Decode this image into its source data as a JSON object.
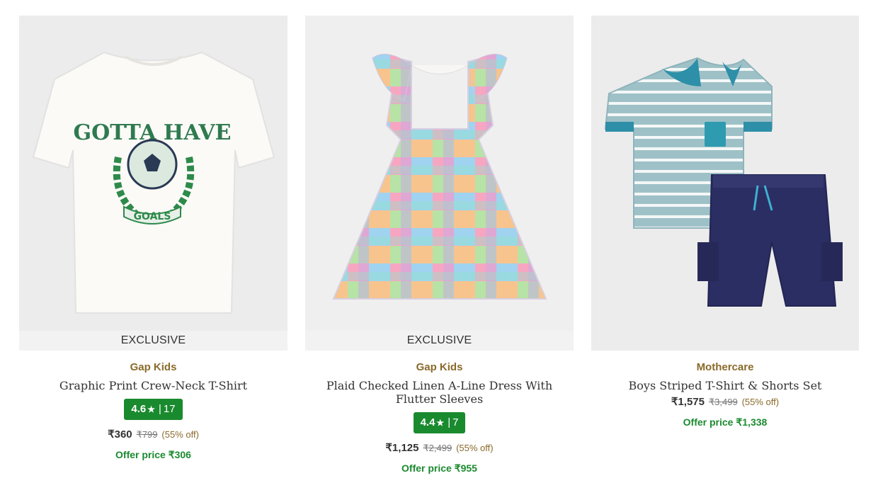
{
  "products": [
    {
      "badge": "EXCLUSIVE",
      "brand": "Gap Kids",
      "name": "Graphic Print Crew-Neck T-Shirt",
      "rating": "4.6",
      "rating_count": "17",
      "price": "₹360",
      "mrp": "₹799",
      "discount": "(55% off)",
      "offer_price": "Offer price ₹306",
      "print_text_top": "GOTTA HAVE",
      "print_text_bottom": "GOALS",
      "image": "white-tshirt-soccer-print"
    },
    {
      "badge": "EXCLUSIVE",
      "brand": "Gap Kids",
      "name": "Plaid Checked Linen A-Line Dress With Flutter Sleeves",
      "rating": "4.4",
      "rating_count": "7",
      "price": "₹1,125",
      "mrp": "₹2,499",
      "discount": "(55% off)",
      "offer_price": "Offer price ₹955",
      "image": "plaid-dress"
    },
    {
      "brand": "Mothercare",
      "name": "Boys Striped T-Shirt & Shorts Set",
      "price": "₹1,575",
      "mrp": "₹3,499",
      "discount": "(55% off)",
      "offer_price": "Offer price ₹1,338",
      "image": "striped-polo-shorts-set"
    }
  ],
  "colors": {
    "brand_text": "#8a6a2a",
    "rating_badge": "#1a8a2e",
    "offer_text": "#1a8a2e",
    "badge_bg": "#f2f2f2"
  }
}
